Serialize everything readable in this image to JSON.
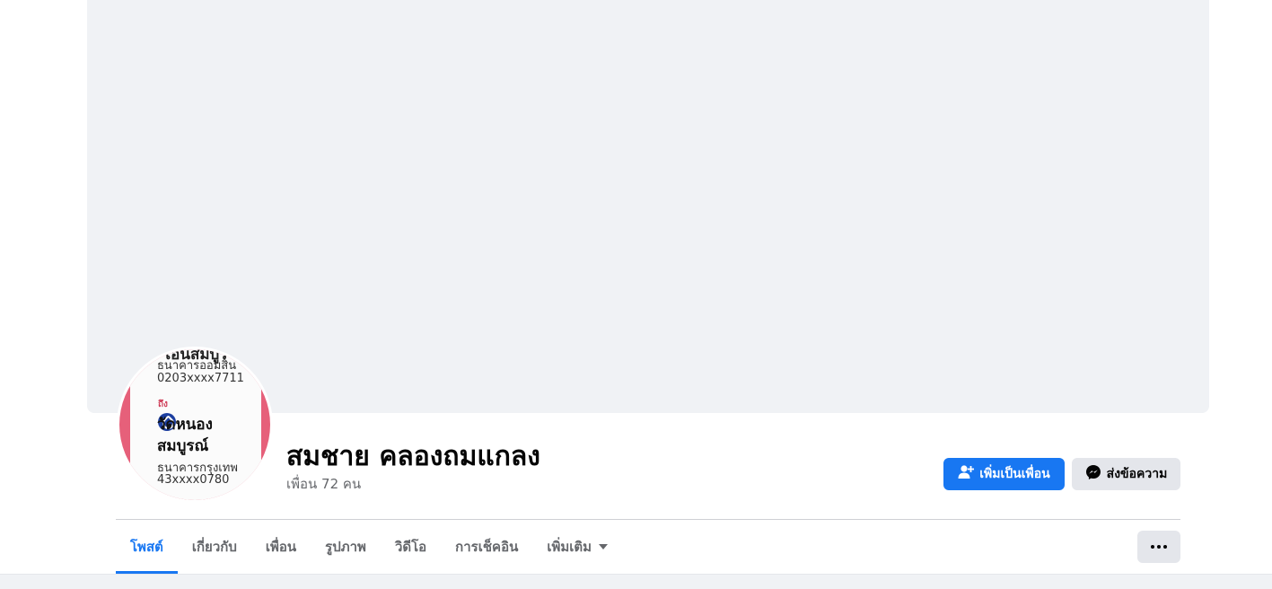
{
  "profile": {
    "name": "สมชาย คลองถมแกลง",
    "friends_text": "เพื่อน 72 คน",
    "avatar_text": {
      "cut_top": "โอนสมบูร",
      "line1": "ธนาคารออมสิน",
      "line2": "0203xxxx7711",
      "red_label": "ถึง",
      "big1": "วัดหนอง",
      "big2": "สมบูรณ์",
      "line3": "ธนาคารกรุงเทพ",
      "line4": "43xxxx0780"
    }
  },
  "actions": {
    "add_friend_label": "เพิ่มเป็นเพื่อน",
    "message_label": "ส่งข้อความ"
  },
  "tabs": [
    {
      "label": "โพสต์",
      "active": true
    },
    {
      "label": "เกี่ยวกับ",
      "active": false
    },
    {
      "label": "เพื่อน",
      "active": false
    },
    {
      "label": "รูปภาพ",
      "active": false
    },
    {
      "label": "วิดีโอ",
      "active": false
    },
    {
      "label": "การเช็คอิน",
      "active": false
    },
    {
      "label": "เพิ่มเติม",
      "active": false
    }
  ],
  "icons": {
    "add_friend": "person-plus-icon",
    "messenger": "messenger-icon",
    "more_caret": "caret-down-icon",
    "more_options": "ellipsis-icon"
  },
  "colors": {
    "accent": "#1877f2",
    "cover": "#f0f2f5",
    "secondary_button": "#e4e6eb",
    "text_secondary": "#65676b"
  }
}
